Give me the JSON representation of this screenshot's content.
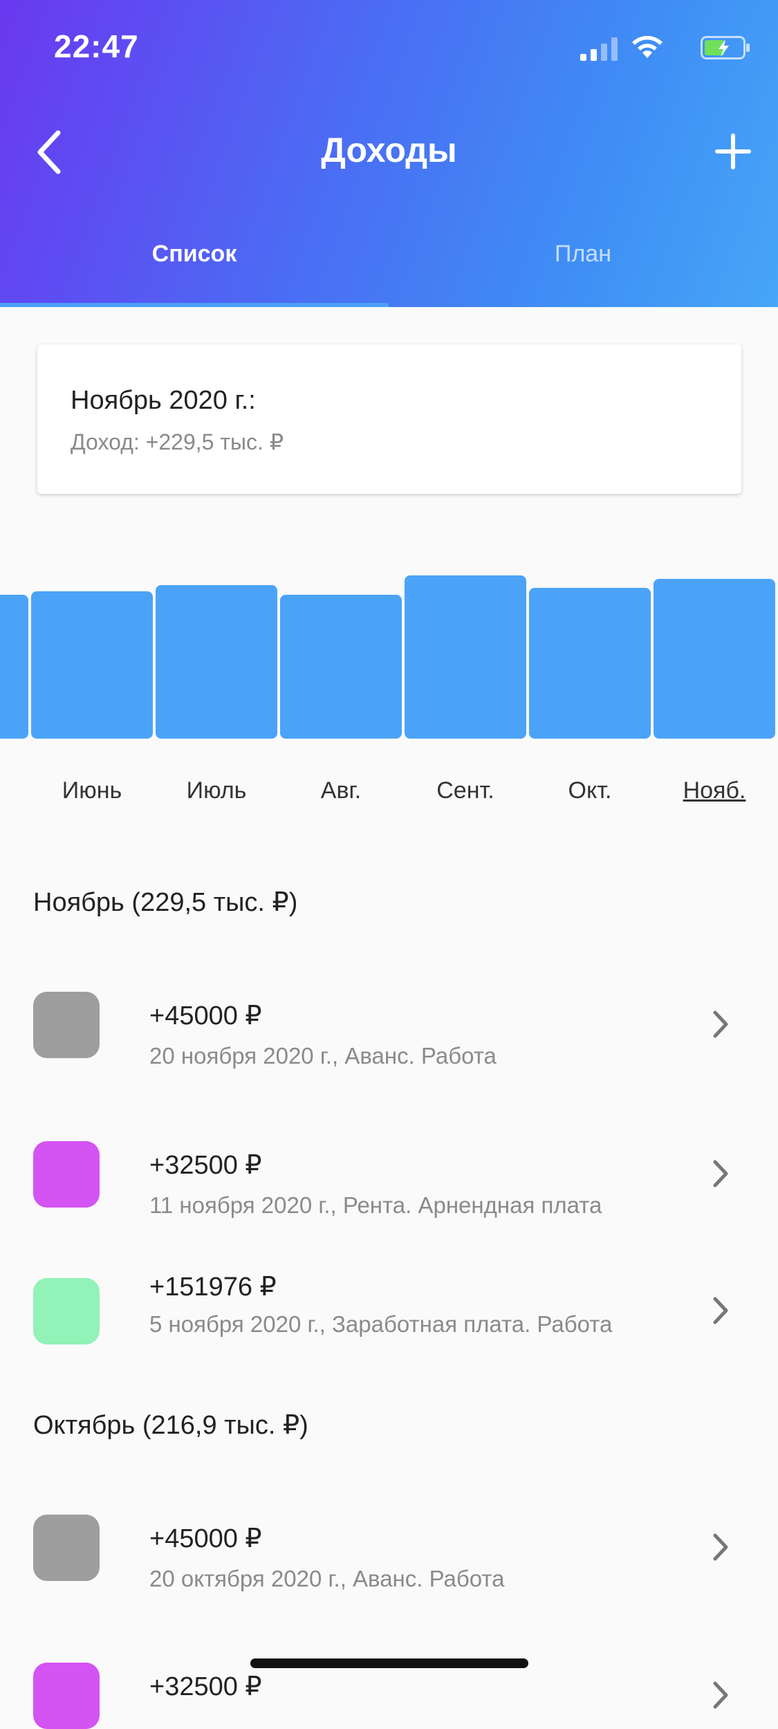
{
  "status_bar": {
    "time": "22:47"
  },
  "header": {
    "title": "Доходы"
  },
  "tabs": [
    {
      "label": "Список",
      "active": true
    },
    {
      "label": "План",
      "active": false
    }
  ],
  "summary": {
    "title": "Ноябрь 2020 г.:",
    "income": "Доход: +229,5 тыс. ₽"
  },
  "chart_data": {
    "type": "bar",
    "categories": [
      "",
      "Июнь",
      "Июль",
      "Авг.",
      "Сент.",
      "Окт.",
      "Нояб."
    ],
    "values": [
      208,
      213,
      222,
      208,
      236,
      218,
      231
    ],
    "selected": "Нояб.",
    "colors": {
      "bar": "#4ba3f7"
    }
  },
  "sections": [
    {
      "header": "Ноябрь (229,5 тыс. ₽)",
      "items": [
        {
          "amount": "+45000 ₽",
          "description": "20 ноября 2020 г., Аванс. Работа",
          "color": "#9e9e9e"
        },
        {
          "amount": "+32500 ₽",
          "description": "11 ноября 2020 г., Рента. Арнендная плата",
          "color": "#d453f3"
        },
        {
          "amount": "+151976 ₽",
          "description": "5 ноября 2020 г., Заработная плата. Работа",
          "color": "#92f2b8"
        }
      ]
    },
    {
      "header": "Октябрь (216,9 тыс. ₽)",
      "items": [
        {
          "amount": "+45000 ₽",
          "description": "20 октября 2020 г., Аванс. Работа",
          "color": "#9e9e9e"
        },
        {
          "amount": "+32500 ₽",
          "description": "",
          "color": "#d453f3"
        }
      ]
    }
  ],
  "icons": {
    "back": "chevron-left-icon",
    "add": "plus-icon",
    "row": "chevron-right-icon"
  }
}
